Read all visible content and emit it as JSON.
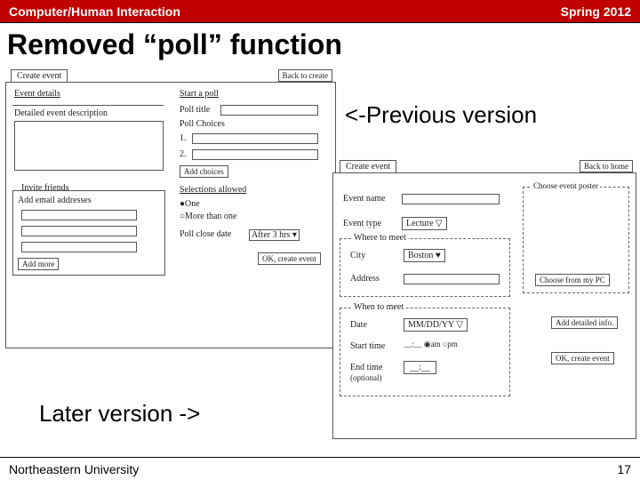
{
  "topbar": {
    "left": "Computer/Human Interaction",
    "right": "Spring 2012"
  },
  "title": "Removed “poll” function",
  "annot": {
    "prev": "<-Previous version",
    "later": "Later version ->"
  },
  "footer": {
    "left": "Northeastern University",
    "right": "17"
  },
  "sketch1": {
    "tab": "Create event",
    "back": "Back to create",
    "left_panel": {
      "header": "Event details",
      "desc": "Detailed event description",
      "invite_header": "Invite friends",
      "invite_desc": "Add email addresses",
      "add": "Add more"
    },
    "right_panel": {
      "header": "Start a poll",
      "title": "Poll title",
      "choices": "Poll Choices",
      "opt1": "1.",
      "opt2": "2.",
      "add_choices": "Add choices",
      "selections": "Selections allowed",
      "radio_one": "●One",
      "radio_more": "○More than one",
      "close": "Poll close date",
      "after": "After  3 hrs ▾",
      "ok": "OK, create event"
    }
  },
  "sketch2": {
    "tab": "Create event",
    "back": "Back to home",
    "name": "Event name",
    "type": "Event type",
    "type_val": "Lecture   ▽",
    "where_header": "Where to meet",
    "city": "City",
    "city_val": "Boston ♥",
    "address": "Address",
    "when_header": "When to meet",
    "date": "Date",
    "date_val": "MM/DD/YY ▽",
    "start": "Start time",
    "start_val": "__:__  ◉am ○pm",
    "end": "End time",
    "end_opt": "(optional)",
    "end_val": "__:__",
    "poster_header": "Choose event poster",
    "poster_btn": "Choose from my PC",
    "detail_btn": "Add detailed info.",
    "ok": "OK, create event"
  }
}
